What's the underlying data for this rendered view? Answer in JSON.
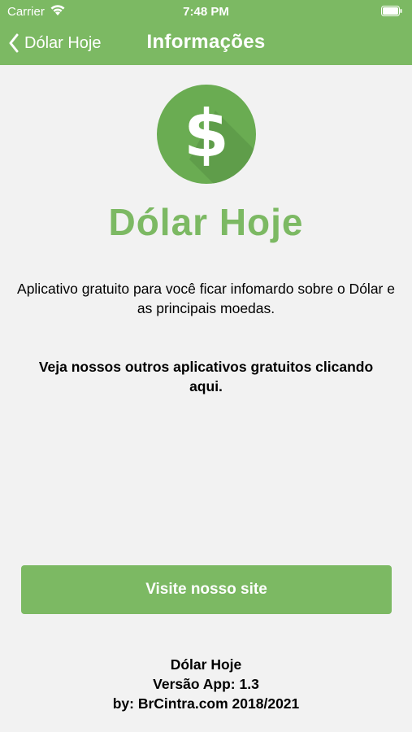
{
  "status_bar": {
    "carrier": "Carrier",
    "time": "7:48 PM"
  },
  "nav": {
    "back_label": "Dólar Hoje",
    "title": "Informações"
  },
  "app": {
    "name": "Dólar Hoje",
    "logo_icon": "dollar-sign-icon",
    "description": "Aplicativo gratuito para você ficar infomardo sobre o Dólar e as principais moedas.",
    "other_apps_link": "Veja nossos outros aplicativos gratuitos clicando aqui."
  },
  "site_button_label": "Visite nosso site",
  "footer": {
    "app_name": "Dólar Hoje",
    "version": "Versão App: 1.3",
    "credits": "by: BrCintra.com 2018/2021"
  },
  "colors": {
    "accent": "#7cb963",
    "background": "#f2f2f2"
  }
}
